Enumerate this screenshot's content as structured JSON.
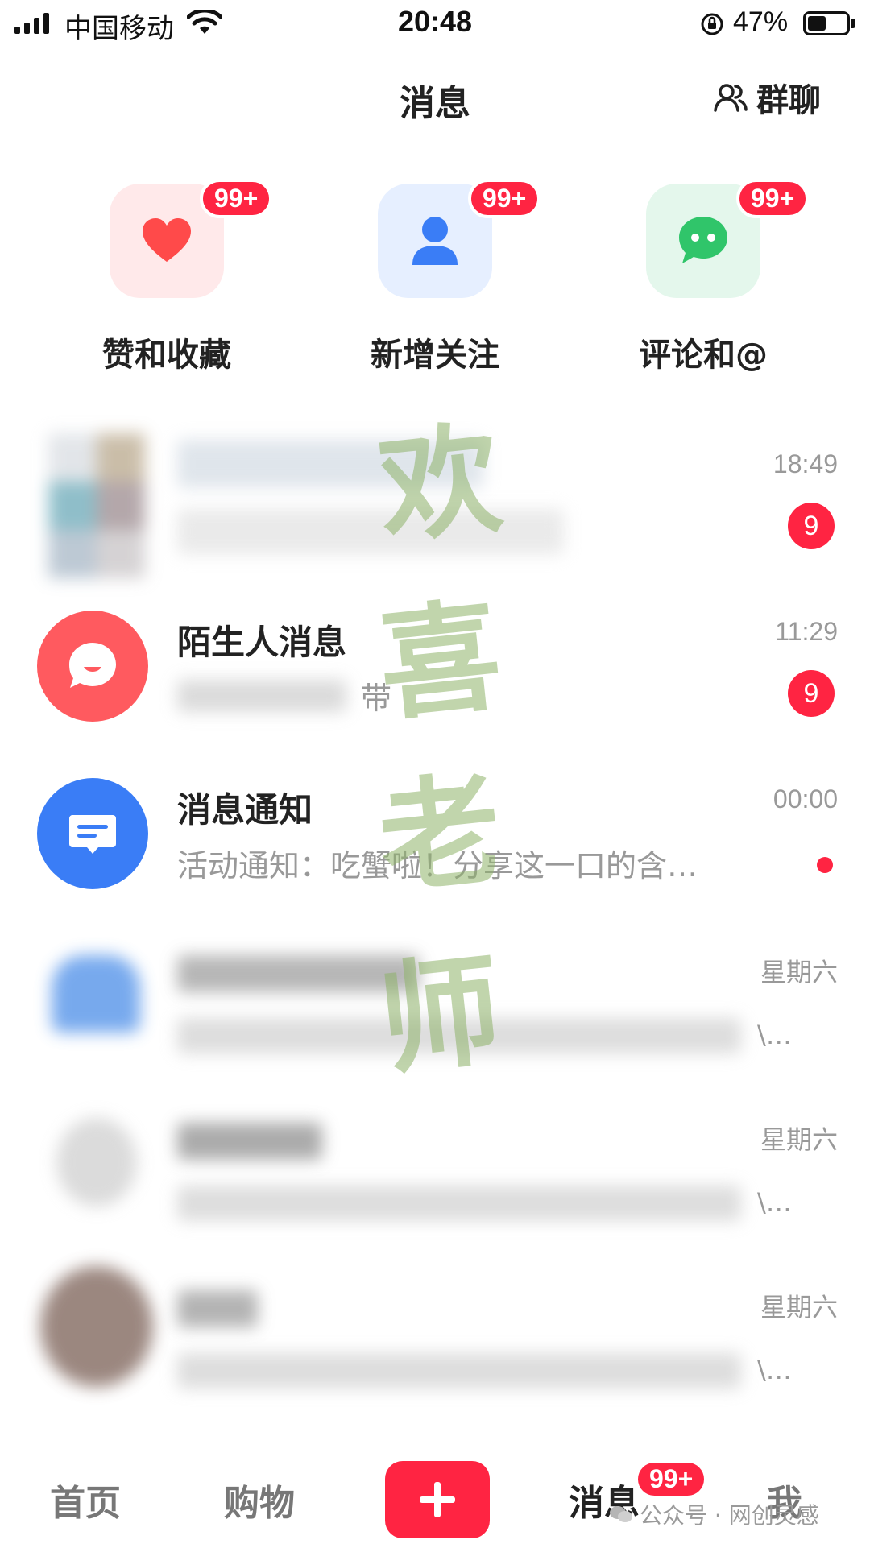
{
  "status_bar": {
    "carrier": "中国移动",
    "time": "20:48",
    "battery": "47%",
    "battery_level": 0.47
  },
  "header": {
    "title": "消息",
    "group_chat_label": "群聊"
  },
  "quick_actions": [
    {
      "label": "赞和收藏",
      "badge": "99+",
      "icon": "heart-icon",
      "color": "#ff4a4a"
    },
    {
      "label": "新增关注",
      "badge": "99+",
      "icon": "person-icon",
      "color": "#3a7df6"
    },
    {
      "label": "评论和@",
      "badge": "99+",
      "icon": "chat-bubble-icon",
      "color": "#30c56a"
    }
  ],
  "conversations": [
    {
      "name": "",
      "preview": "",
      "time": "18:49",
      "count": "9",
      "blurred": true
    },
    {
      "name": "陌生人消息",
      "preview": "带",
      "time": "11:29",
      "count": "9",
      "icon": "stranger-message-icon",
      "color": "#ff5a5f"
    },
    {
      "name": "消息通知",
      "preview": "活动通知：吃蟹啦！分享这一口的含…",
      "time": "00:00",
      "dot": true,
      "icon": "notification-icon",
      "color": "#3a7df6"
    },
    {
      "name": "",
      "preview": "",
      "time": "星期六",
      "trail": "\\…",
      "blurred": true
    },
    {
      "name": "",
      "preview": "",
      "time": "星期六",
      "trail": "\\…",
      "blurred": true
    },
    {
      "name": "",
      "preview": "",
      "time": "星期六",
      "trail": "\\…",
      "blurred": true
    }
  ],
  "tabbar": {
    "home": "首页",
    "shop": "购物",
    "messages": "消息",
    "messages_badge": "99+",
    "me": "我"
  },
  "watermark": {
    "chars": [
      "欢",
      "喜",
      "老",
      "师"
    ],
    "credit": "公众号 · 网创灵感"
  },
  "colors": {
    "accent": "#ff2442",
    "watermark": "#8fb36a"
  }
}
